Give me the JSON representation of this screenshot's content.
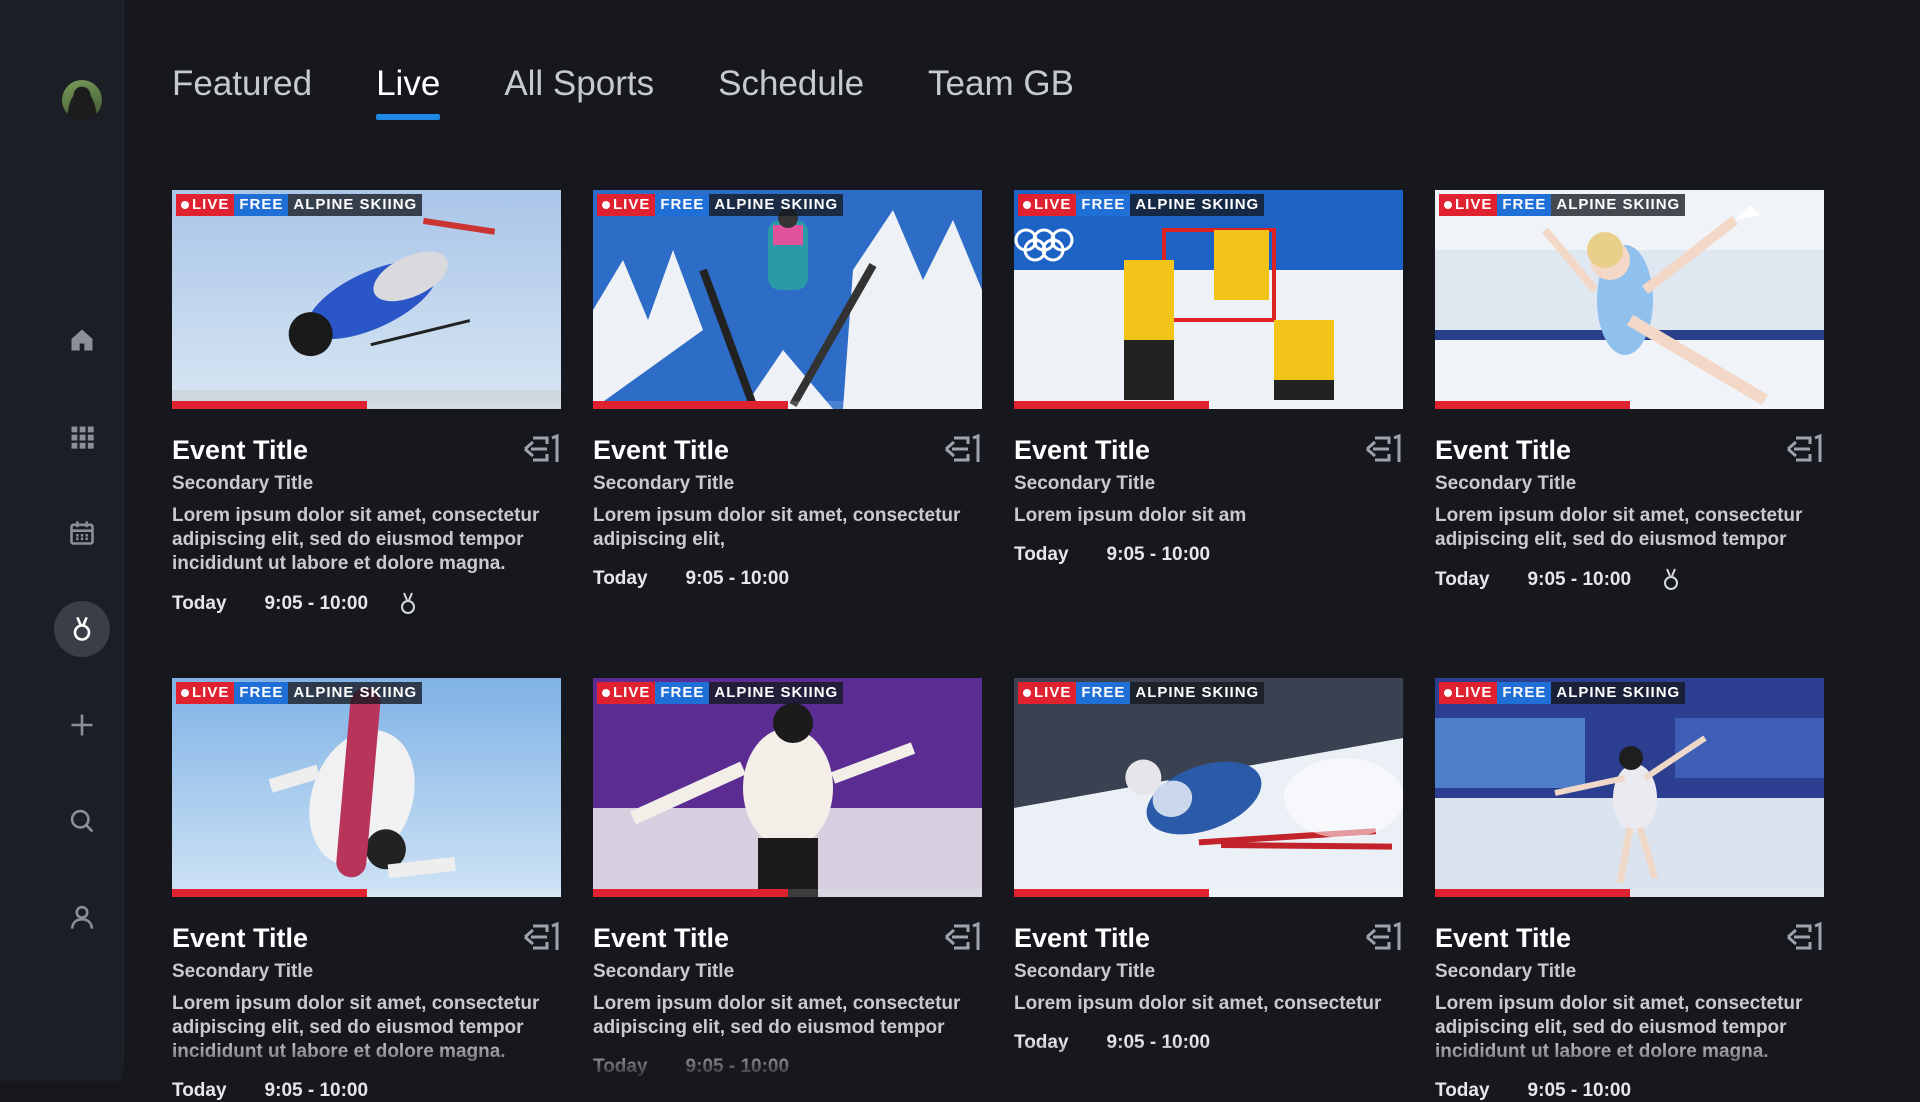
{
  "nav": {
    "avatar": "avatar",
    "items": [
      {
        "name": "home",
        "icon": "home-icon"
      },
      {
        "name": "categories",
        "icon": "grid-icon"
      },
      {
        "name": "schedule",
        "icon": "calendar-icon"
      },
      {
        "name": "medals",
        "icon": "medal-icon",
        "active": true
      },
      {
        "name": "add",
        "icon": "plus-icon"
      },
      {
        "name": "search",
        "icon": "search-icon"
      },
      {
        "name": "profile",
        "icon": "user-icon"
      }
    ]
  },
  "tabs": [
    {
      "label": "Featured"
    },
    {
      "label": "Live",
      "active": true
    },
    {
      "label": "All Sports"
    },
    {
      "label": "Schedule"
    },
    {
      "label": "Team GB"
    }
  ],
  "badges": {
    "live": "LIVE",
    "free": "FREE"
  },
  "cards": [
    {
      "sport": "ALPINE SKIING",
      "title": "Event Title",
      "secondary": "Secondary Title",
      "desc": "Lorem ipsum dolor sit amet, consectetur adipiscing elit, sed do eiusmod tempor incididunt ut labore et dolore magna.",
      "day": "Today",
      "time": "9:05 - 10:00",
      "medal": true,
      "progress": 0.5,
      "scene": "freestyle-ski-jump"
    },
    {
      "sport": "ALPINE SKIING",
      "title": "Event Title",
      "secondary": "Secondary Title",
      "desc": "Lorem ipsum dolor sit amet, consectetur adipiscing elit,",
      "day": "Today",
      "time": "9:05 - 10:00",
      "medal": false,
      "progress": 0.5,
      "scene": "ski-jumping"
    },
    {
      "sport": "ALPINE SKIING",
      "title": "Event Title",
      "secondary": "Secondary Title",
      "desc": "Lorem ipsum dolor sit am",
      "day": "Today",
      "time": "9:05 - 10:00",
      "medal": false,
      "progress": 0.5,
      "scene": "ice-hockey"
    },
    {
      "sport": "ALPINE SKIING",
      "title": "Event Title",
      "secondary": "Secondary Title",
      "desc": "Lorem ipsum dolor sit amet, consectetur adipiscing elit, sed do eiusmod tempor",
      "day": "Today",
      "time": "9:05 - 10:00",
      "medal": true,
      "progress": 0.5,
      "scene": "figure-skating"
    },
    {
      "sport": "ALPINE SKIING",
      "title": "Event Title",
      "secondary": "Secondary Title",
      "desc": "Lorem ipsum dolor sit amet, consectetur adipiscing elit, sed do eiusmod tempor incididunt ut labore et dolore magna.",
      "day": "Today",
      "time": "9:05 - 10:00",
      "medal": false,
      "progress": 0.5,
      "scene": "snowboard"
    },
    {
      "sport": "ALPINE SKIING",
      "title": "Event Title",
      "secondary": "Secondary Title",
      "desc": "Lorem ipsum dolor sit amet, consectetur adipiscing elit, sed do eiusmod tempor",
      "day": "Today",
      "time": "9:05 - 10:00",
      "medal": false,
      "progress": 0.5,
      "scene": "figure-skating-men"
    },
    {
      "sport": "ALPINE SKIING",
      "title": "Event Title",
      "secondary": "Secondary Title",
      "desc": "Lorem ipsum dolor sit amet, consectetur",
      "day": "Today",
      "time": "9:05 - 10:00",
      "medal": false,
      "progress": 0.5,
      "scene": "downhill-ski"
    },
    {
      "sport": "ALPINE SKIING",
      "title": "Event Title",
      "secondary": "Secondary Title",
      "desc": "Lorem ipsum dolor sit amet, consectetur adipiscing elit, sed do eiusmod tempor incididunt ut labore et dolore magna.",
      "day": "Today",
      "time": "9:05 - 10:00",
      "medal": false,
      "progress": 0.5,
      "scene": "figure-skating-beijing"
    }
  ],
  "colors": {
    "accent": "#1e88e5",
    "live": "#e0212f",
    "free": "#1f6fd6",
    "background": "#16181e"
  }
}
